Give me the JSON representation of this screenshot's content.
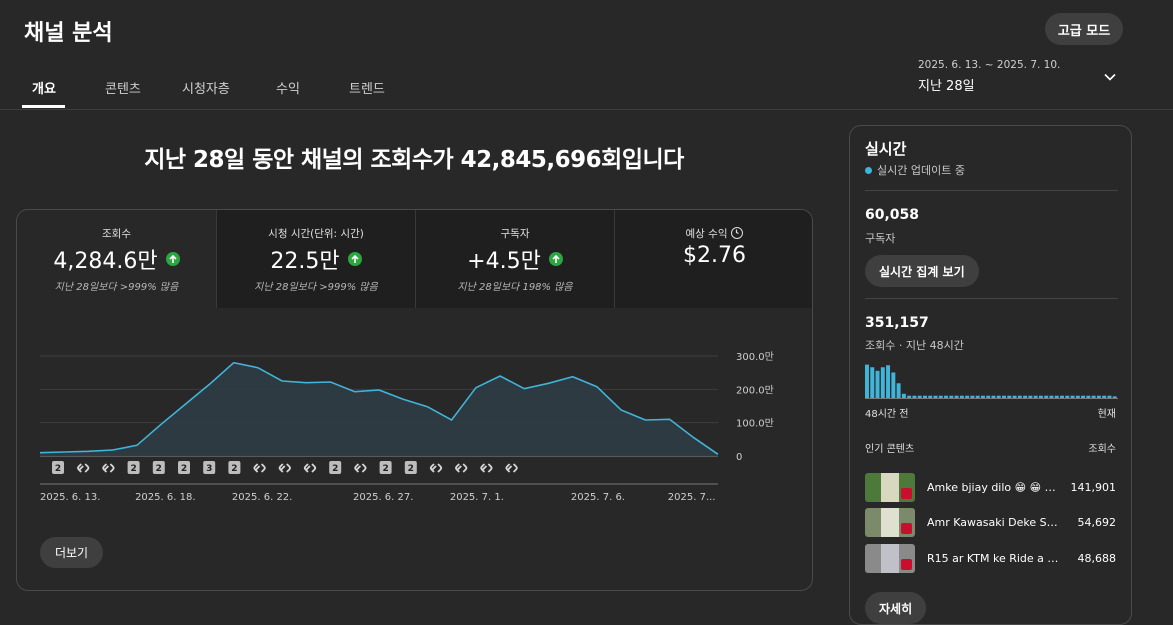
{
  "header": {
    "title": "채널 분석",
    "advanced_mode": "고급 모드",
    "tabs": [
      "개요",
      "콘텐츠",
      "시청자층",
      "수익",
      "트렌드"
    ],
    "active_tab": "개요",
    "date_range": "2025. 6. 13. ~ 2025. 7. 10.",
    "date_label": "지난 28일"
  },
  "headline": "지난 28일 동안 채널의 조회수가 42,845,696회입니다",
  "metrics": [
    {
      "label": "조회수",
      "value": "4,284.6만",
      "sub": "지난 28일보다 >999% 많음",
      "trend": "up"
    },
    {
      "label": "시청 시간(단위: 시간)",
      "value": "22.5만",
      "sub": "지난 28일보다 >999% 많음",
      "trend": "up"
    },
    {
      "label": "구독자",
      "value": "+4.5만",
      "sub": "지난 28일보다 198% 많음",
      "trend": "up"
    },
    {
      "label": "예상 수익",
      "value": "$2.76",
      "sub": "",
      "trend": "none"
    }
  ],
  "more_button": "더보기",
  "chart_data": {
    "type": "area",
    "series": [
      {
        "values": [
          10,
          12,
          14,
          18,
          32,
          95,
          155,
          215,
          280,
          265,
          225,
          220,
          222,
          193,
          198,
          170,
          148,
          108,
          205,
          240,
          202,
          218,
          238,
          208,
          138,
          108,
          110,
          55,
          5
        ]
      }
    ],
    "y_ticks": [
      "300.0만",
      "200.0만",
      "100.0만",
      "0"
    ],
    "ylim": [
      0,
      330
    ],
    "x_ticks": [
      "2025. 6. 13.",
      "2025. 6. 18.",
      "2025. 6. 22.",
      "2025. 6. 27.",
      "2025. 7. 1.",
      "2025. 7. 6.",
      "2025. 7..."
    ],
    "markers": [
      "2",
      "link",
      "link",
      "2",
      "2",
      "2",
      "3",
      "2",
      "link",
      "link",
      "link",
      "2",
      "link",
      "2",
      "2",
      "link",
      "link",
      "link",
      "link"
    ],
    "color": "#41b4d9"
  },
  "realtime": {
    "title": "실시간",
    "status": "실시간 업데이트 중",
    "subscribers": "60,058",
    "subscribers_label": "구독자",
    "realtime_button": "실시간 집계 보기",
    "views": "351,157",
    "views_label": "조회수 · 지난 48시간",
    "bar_values": [
      10.2,
      9.4,
      8.3,
      9.4,
      10.0,
      7.8,
      4.5,
      1.3,
      0.7,
      0.7,
      0.7,
      0.7,
      0.7,
      0.7,
      0.7,
      0.7,
      0.7,
      0.7,
      0.7,
      0.7,
      0.7,
      0.7,
      0.7,
      0.7,
      0.7,
      0.7,
      0.7,
      0.7,
      0.7,
      0.7,
      0.7,
      0.7,
      0.7,
      0.7,
      0.7,
      0.7,
      0.7,
      0.7,
      0.7,
      0.7,
      0.7,
      0.7,
      0.7,
      0.7,
      0.7,
      0.7,
      0.7,
      0.5
    ],
    "bar_max": 11,
    "left_axis": "48시간 전",
    "right_axis": "현재",
    "popular_label": "인기 콘텐츠",
    "popular_views_label": "조회수",
    "popular": [
      {
        "title": "Amke bjiay dilo 😁 😁 …",
        "views": "141,901"
      },
      {
        "title": "Amr Kawasaki Deke Sor…",
        "views": "54,692"
      },
      {
        "title": "R15 ar KTM ke Ride a ni…",
        "views": "48,688"
      }
    ],
    "bottom_button": "자세히"
  },
  "colors": {
    "accent": "#41b4d9",
    "up": "#2ba640",
    "bg": "#282828",
    "card": "#1f1f1f"
  }
}
